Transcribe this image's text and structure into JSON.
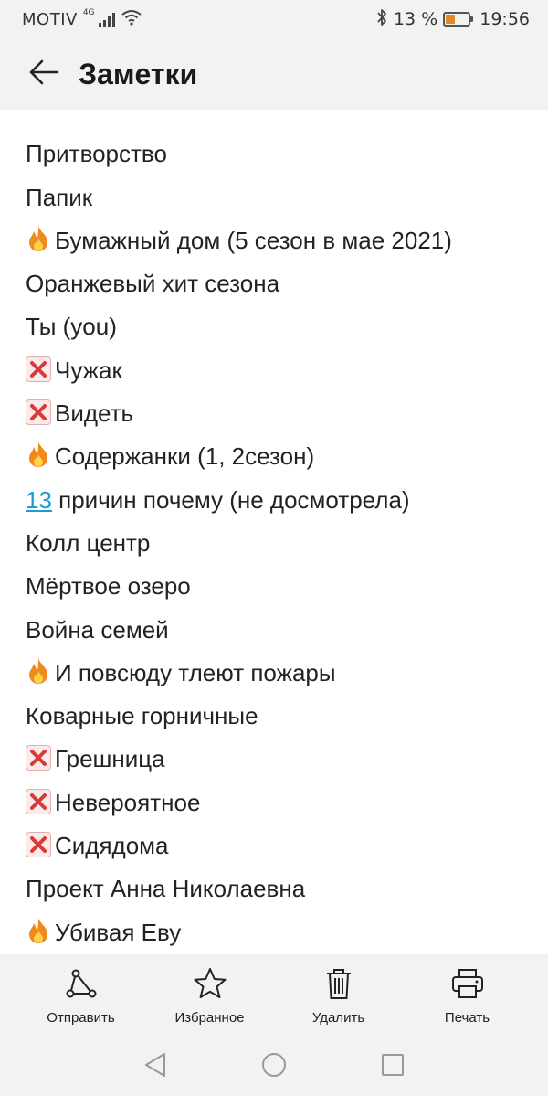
{
  "status_bar": {
    "carrier": "MOTIV",
    "network_type": "4G",
    "battery_text": "13 %",
    "battery_level": 0.13,
    "time": "19:56",
    "icons": [
      "signal-icon",
      "wifi-icon",
      "bluetooth-icon",
      "battery-icon"
    ]
  },
  "header": {
    "title": "Заметки",
    "back_icon": "arrow-left-icon"
  },
  "notes": [
    {
      "mark": "",
      "text": "Притворство"
    },
    {
      "mark": "",
      "text": "Папик"
    },
    {
      "mark": "fire",
      "text": "Бумажный дом (5 сезон в мае 2021)"
    },
    {
      "mark": "",
      "text": "Оранжевый хит сезона"
    },
    {
      "mark": "",
      "text": "Ты (you)"
    },
    {
      "mark": "cross",
      "text": "Чужак"
    },
    {
      "mark": "cross",
      "text": "Видеть"
    },
    {
      "mark": "fire",
      "text": "Содержанки (1, 2сезон)"
    },
    {
      "mark": "",
      "link": "13",
      "text": " причин почему (не досмотрела)"
    },
    {
      "mark": "",
      "text": "Колл центр"
    },
    {
      "mark": "",
      "text": "Мёртвое озеро"
    },
    {
      "mark": "",
      "text": "Война семей"
    },
    {
      "mark": "fire",
      "text": "И повсюду тлеют пожары"
    },
    {
      "mark": "",
      "text": "Коварные горничные"
    },
    {
      "mark": "cross",
      "text": "Грешница"
    },
    {
      "mark": "cross",
      "text": "Невероятное"
    },
    {
      "mark": "cross",
      "text": "Сидядома"
    },
    {
      "mark": "",
      "text": "Проект Анна Николаевна"
    },
    {
      "mark": "fire",
      "text": "Убивая Еву"
    }
  ],
  "actions": [
    {
      "label": "Отправить",
      "icon": "share-icon"
    },
    {
      "label": "Избранное",
      "icon": "star-icon"
    },
    {
      "label": "Удалить",
      "icon": "trash-icon"
    },
    {
      "label": "Печать",
      "icon": "printer-icon"
    }
  ],
  "colors": {
    "link": "#1e9ad6",
    "bar_background": "#f2f2f2",
    "cross_mark": "#d93a3a",
    "fire_mark": "#f08a1c"
  }
}
